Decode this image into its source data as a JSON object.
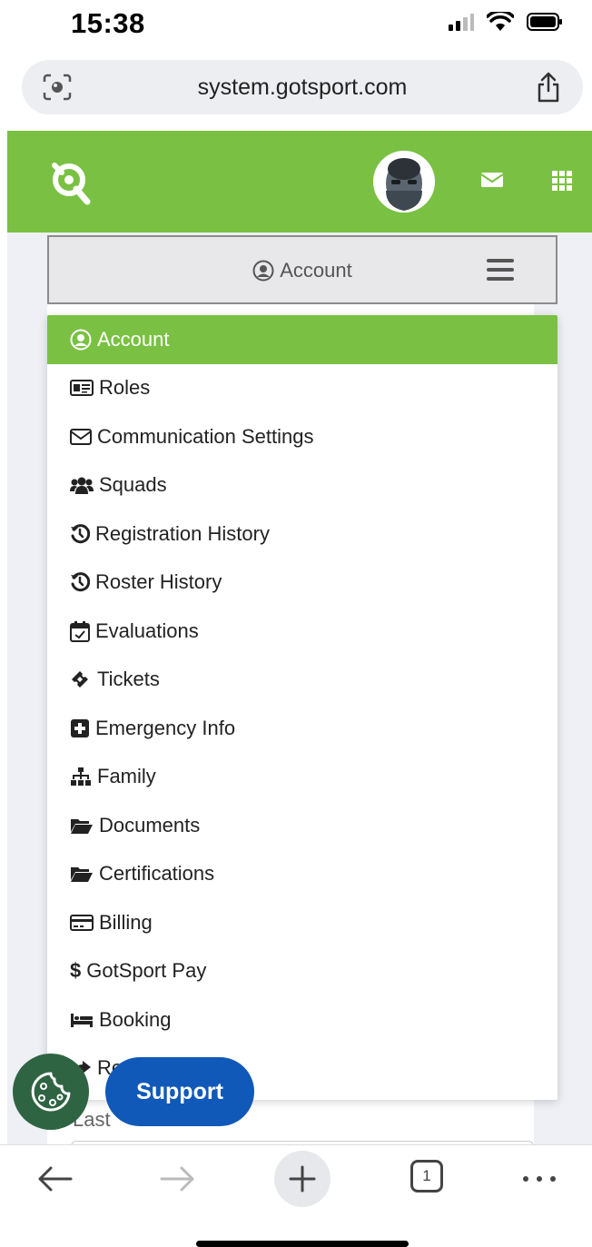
{
  "status_bar": {
    "time": "15:38"
  },
  "browser": {
    "url": "system.gotsport.com",
    "tab_count": "1"
  },
  "header": {
    "brand": "GotSport"
  },
  "account_toggle": {
    "label": "Account"
  },
  "menu": {
    "items": [
      {
        "label": "Account",
        "icon": "user-circle-icon",
        "active": true
      },
      {
        "label": "Roles",
        "icon": "id-card-icon"
      },
      {
        "label": "Communication Settings",
        "icon": "envelope-icon"
      },
      {
        "label": "Squads",
        "icon": "users-icon"
      },
      {
        "label": "Registration History",
        "icon": "history-icon"
      },
      {
        "label": "Roster History",
        "icon": "history-icon"
      },
      {
        "label": "Evaluations",
        "icon": "calendar-check-icon"
      },
      {
        "label": "Tickets",
        "icon": "ticket-icon"
      },
      {
        "label": "Emergency Info",
        "icon": "plus-square-icon"
      },
      {
        "label": "Family",
        "icon": "sitemap-icon"
      },
      {
        "label": "Documents",
        "icon": "folder-open-icon"
      },
      {
        "label": "Certifications",
        "icon": "folder-open-icon"
      },
      {
        "label": "Billing",
        "icon": "credit-card-icon"
      },
      {
        "label": "GotSport Pay",
        "icon": "dollar-icon"
      },
      {
        "label": "Booking",
        "icon": "bed-icon"
      },
      {
        "label": "Re…file",
        "icon": "share-icon"
      }
    ]
  },
  "form": {
    "partial_label": "Last"
  },
  "support": {
    "label": "Support"
  },
  "colors": {
    "brand_green": "#7ac143",
    "support_blue": "#1159b8",
    "cookie_green": "#2f6442"
  }
}
